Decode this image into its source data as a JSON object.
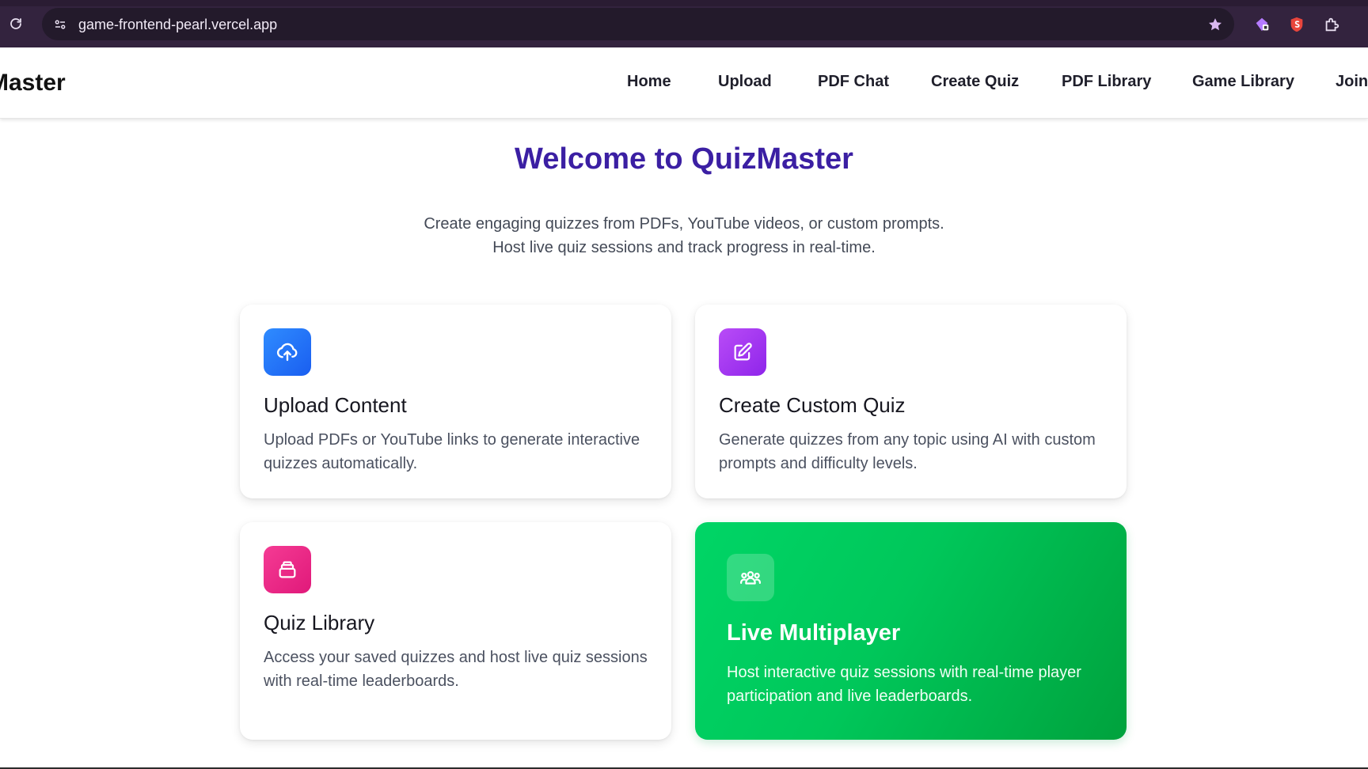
{
  "browser": {
    "url": "game-frontend-pearl.vercel.app",
    "icons": [
      "reload-icon",
      "site-info-icon",
      "star-icon",
      "extension-icon",
      "extension-icon",
      "puzzle-icon"
    ]
  },
  "nav": {
    "brand": "Master",
    "links": [
      "Home",
      "Upload",
      "PDF Chat",
      "Create Quiz",
      "PDF Library",
      "Game Library",
      "Join"
    ]
  },
  "hero": {
    "title": "Welcome to QuizMaster",
    "subtitle_line1": "Create engaging quizzes from PDFs, YouTube videos, or custom prompts.",
    "subtitle_line2": "Host live quiz sessions and track progress in real-time."
  },
  "cards": [
    {
      "icon": "cloud-upload-icon",
      "title": "Upload Content",
      "desc": "Upload PDFs or YouTube links to generate interactive quizzes automatically.",
      "accent": "#1e6ef5"
    },
    {
      "icon": "edit-icon",
      "title": "Create Custom Quiz",
      "desc": "Generate quizzes from any topic using AI with custom prompts and difficulty levels.",
      "accent": "#a02cf0"
    },
    {
      "icon": "library-icon",
      "title": "Quiz Library",
      "desc": "Access your saved quizzes and host live quiz sessions with real-time leaderboards.",
      "accent": "#ec2784"
    },
    {
      "icon": "users-icon",
      "title": "Live Multiplayer",
      "desc": "Host interactive quiz sessions with real-time player participation and live leaderboards.",
      "accent": "#00c75a"
    }
  ],
  "colors": {
    "title": "#3b1fa3",
    "browser_bar": "#33233e"
  }
}
